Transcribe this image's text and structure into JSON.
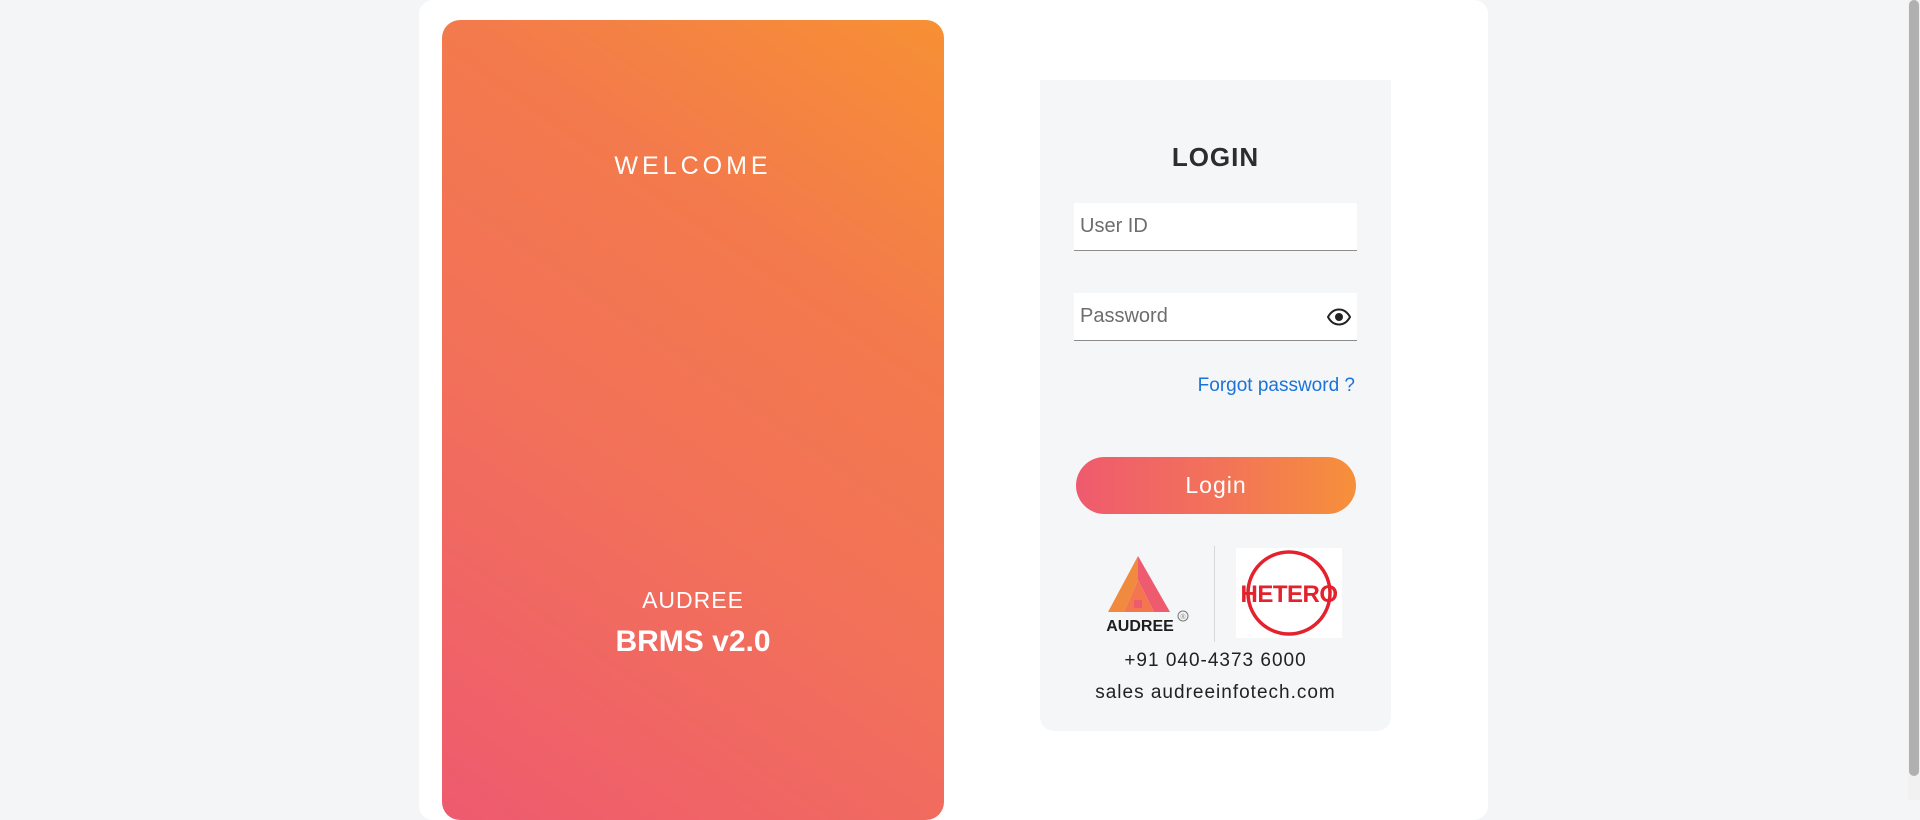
{
  "welcome_panel": {
    "title": "WELCOME",
    "brand": "AUDREE",
    "version": "BRMS v2.0"
  },
  "login_form": {
    "title": "LOGIN",
    "user_id": {
      "value": "",
      "placeholder": "User ID"
    },
    "password": {
      "value": "",
      "placeholder": "Password"
    },
    "forgot_password_label": "Forgot password ?",
    "login_button_label": "Login"
  },
  "logos": {
    "audree": {
      "text": "AUDREE",
      "mark": "®"
    },
    "hetero": {
      "text": "HETERO"
    }
  },
  "contact": {
    "phone": "+91 040-4373 6000",
    "email": "sales audreeinfotech.com"
  },
  "colors": {
    "accent_orange": "#f79034",
    "accent_pink": "#ee5a6f",
    "link_blue": "#1a73d9",
    "hetero_red": "#e3222d"
  },
  "icons": {
    "password_toggle": "eye-icon"
  }
}
